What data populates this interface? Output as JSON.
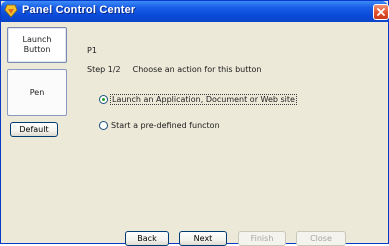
{
  "window": {
    "title": "Panel Control Center"
  },
  "sidebar": {
    "items": [
      {
        "label_line1": "Launch",
        "label_line2": "Button",
        "selected": true
      },
      {
        "label": "Pen"
      }
    ],
    "default_button": "Default"
  },
  "main": {
    "button_id": "P1",
    "step": "Step 1/2",
    "instruction": "Choose an action for this button",
    "options": [
      {
        "label": "Launch an Application, Document or Web site",
        "selected": true
      },
      {
        "label": "Start a pre-defined functon",
        "selected": false
      }
    ]
  },
  "footer": {
    "back": "Back",
    "next": "Next",
    "finish": "Finish",
    "close": "Close"
  },
  "colors": {
    "titlebar": "#0a4ad8",
    "window_bg": "#ece9d8",
    "close_button": "#e0502a"
  },
  "icons": {
    "app": "app-icon",
    "close": "close-icon"
  }
}
